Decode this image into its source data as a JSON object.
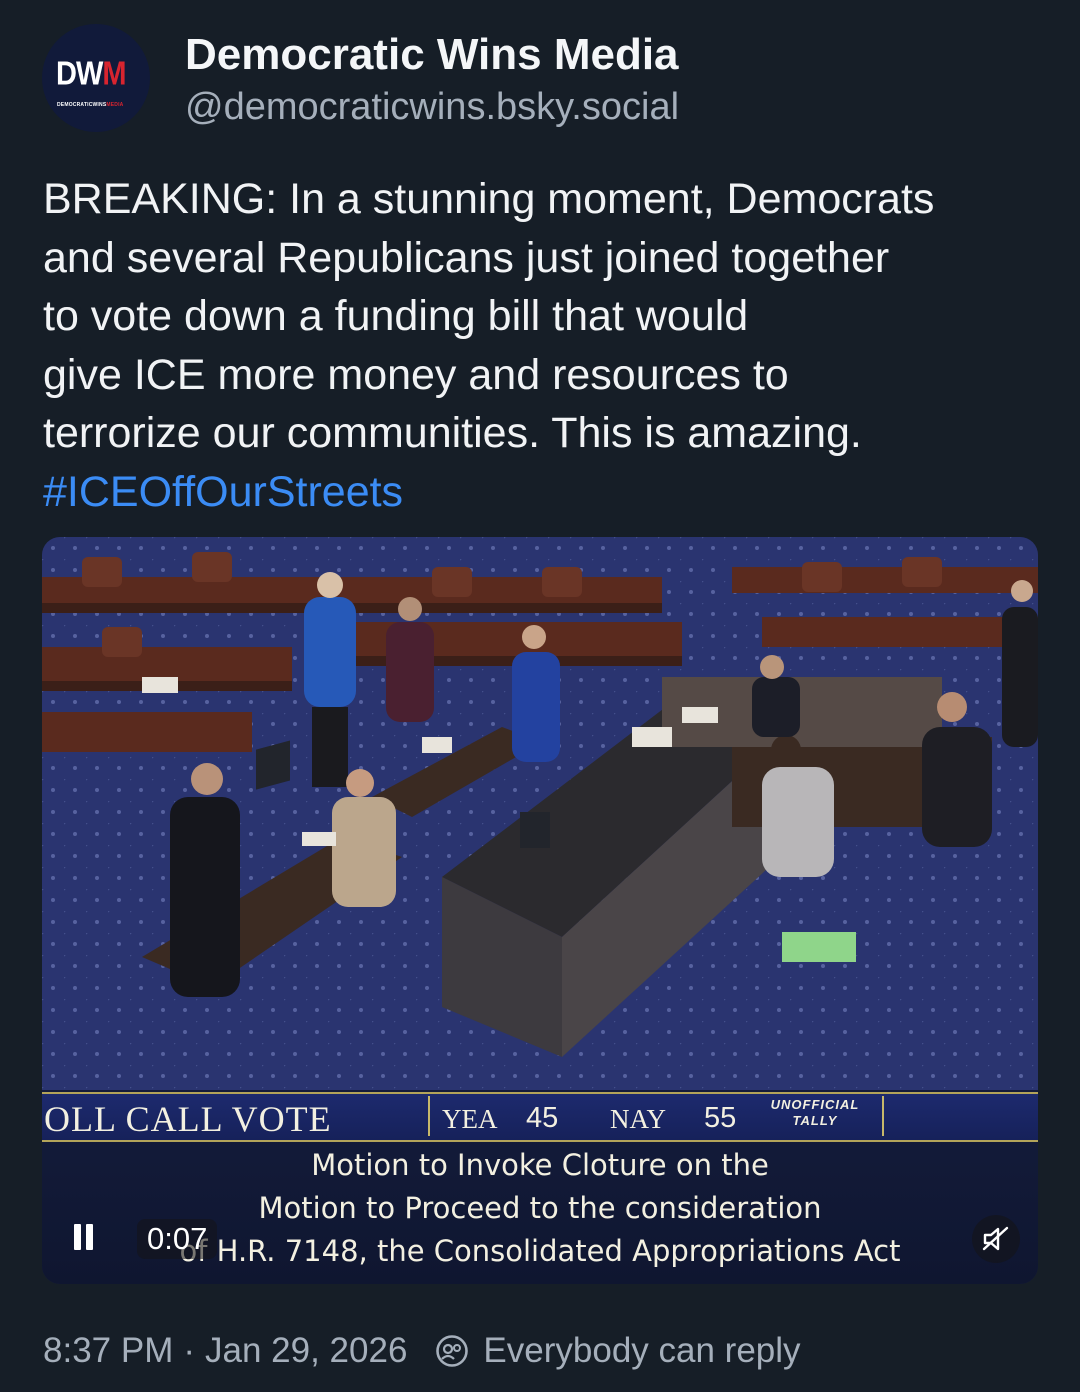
{
  "author": {
    "display_name": "Democratic Wins Media",
    "handle": "@democraticwins.bsky.social",
    "avatar": {
      "logo_main_white": "DW",
      "logo_main_red": "M",
      "logo_sub_white": "DEMOCRATICWINS",
      "logo_sub_red": "MEDIA"
    }
  },
  "post": {
    "lines": [
      "BREAKING: In a stunning moment, Democrats",
      "and several Republicans just joined together",
      "to vote down a funding bill that would",
      "give ICE more money and resources to",
      "terrorize our communities. This is amazing."
    ],
    "hashtag": "#ICEOffOurStreets"
  },
  "video": {
    "vote_title": "OLL CALL VOTE",
    "yea_label": "YEA",
    "yea_count": "45",
    "nay_label": "NAY",
    "nay_count": "55",
    "tally_line1": "UNOFFICIAL",
    "tally_line2": "TALLY",
    "motion_line1": "Motion to Invoke Cloture on the",
    "motion_line2": "Motion to Proceed to the consideration",
    "motion_line3": "of H.R. 7148, the Consolidated Appropriations Act",
    "time": "0:07",
    "state": "playing",
    "muted": true
  },
  "footer": {
    "time": "8:37 PM",
    "separator": "·",
    "date": "Jan 29, 2026",
    "reply_setting": "Everybody can reply"
  },
  "colors": {
    "background": "#161e27",
    "text": "#f1f3f5",
    "muted_text": "#a5afbb",
    "hashtag": "#3b8cf5",
    "brand_red": "#d8242f",
    "vote_bar": "#1d2a6e",
    "vote_bar_border": "#b3a45a"
  },
  "icons": [
    "pause-icon",
    "mute-icon",
    "reply-settings-icon"
  ]
}
